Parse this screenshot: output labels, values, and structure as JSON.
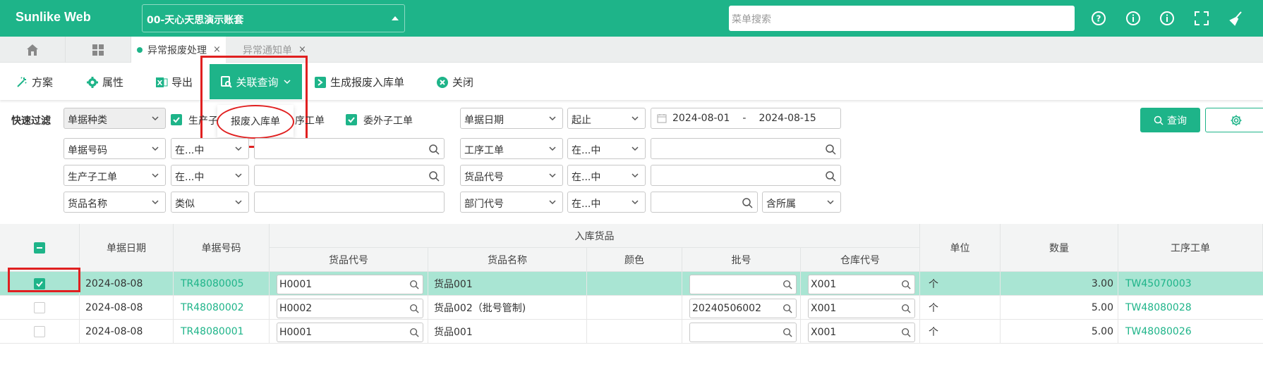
{
  "app": {
    "title": "Sunlike Web",
    "account": "00-天心天思演示账套",
    "search_placeholder": "菜单搜索"
  },
  "tabs": [
    {
      "label": "异常报废处理",
      "close": "×"
    },
    {
      "label": "异常通知单",
      "close": "×"
    }
  ],
  "toolbar": {
    "scheme": "方案",
    "props": "属性",
    "export": "导出",
    "related_query": "关联查询",
    "generate": "生成报废入库单",
    "close": "关闭",
    "dropdown_item": "报废入库单"
  },
  "filter": {
    "quick_filter": "快速过滤",
    "doc_type": "单据种类",
    "cb_prod_sub": "生产子",
    "cb_process": "序工单",
    "cb_outsource": "委外子工单",
    "doc_date": "单据日期",
    "range_op": "起止",
    "date_from": "2024-08-01",
    "date_sep": "-",
    "date_to": "2024-08-15",
    "doc_no": "单据号码",
    "in_op1": "在...中",
    "process_order": "工序工单",
    "in_op2": "在...中",
    "prod_sub_order": "生产子工单",
    "in_op3": "在...中",
    "item_code": "货品代号",
    "in_op4": "在...中",
    "item_name": "货品名称",
    "like_op": "类似",
    "dept_code": "部门代号",
    "in_op5": "在...中",
    "incl_sub": "含所属",
    "query_btn": "查询"
  },
  "grid": {
    "headers": {
      "date": "单据日期",
      "doc_no": "单据号码",
      "group": "入库货品",
      "item_code": "货品代号",
      "item_name": "货品名称",
      "color": "颜色",
      "batch": "批号",
      "wh": "仓库代号",
      "unit": "单位",
      "qty": "数量",
      "proc": "工序工单"
    },
    "rows": [
      {
        "checked": true,
        "date": "2024-08-08",
        "doc_no": "TR48080005",
        "item_code": "H0001",
        "item_name": "货品001",
        "color": "",
        "batch": "",
        "wh": "X001",
        "unit": "个",
        "qty": "3.00",
        "proc": "TW45070003"
      },
      {
        "checked": false,
        "date": "2024-08-08",
        "doc_no": "TR48080002",
        "item_code": "H0002",
        "item_name": "货品002（批号管制)",
        "color": "",
        "batch": "20240506002",
        "wh": "X001",
        "unit": "个",
        "qty": "5.00",
        "proc": "TW48080028"
      },
      {
        "checked": false,
        "date": "2024-08-08",
        "doc_no": "TR48080001",
        "item_code": "H0001",
        "item_name": "货品001",
        "color": "",
        "batch": "",
        "wh": "X001",
        "unit": "个",
        "qty": "5.00",
        "proc": "TW48080026"
      }
    ]
  },
  "colors": {
    "accent": "#1eb489",
    "highlight_row": "#a9e5d3",
    "annotation": "#e02020"
  }
}
